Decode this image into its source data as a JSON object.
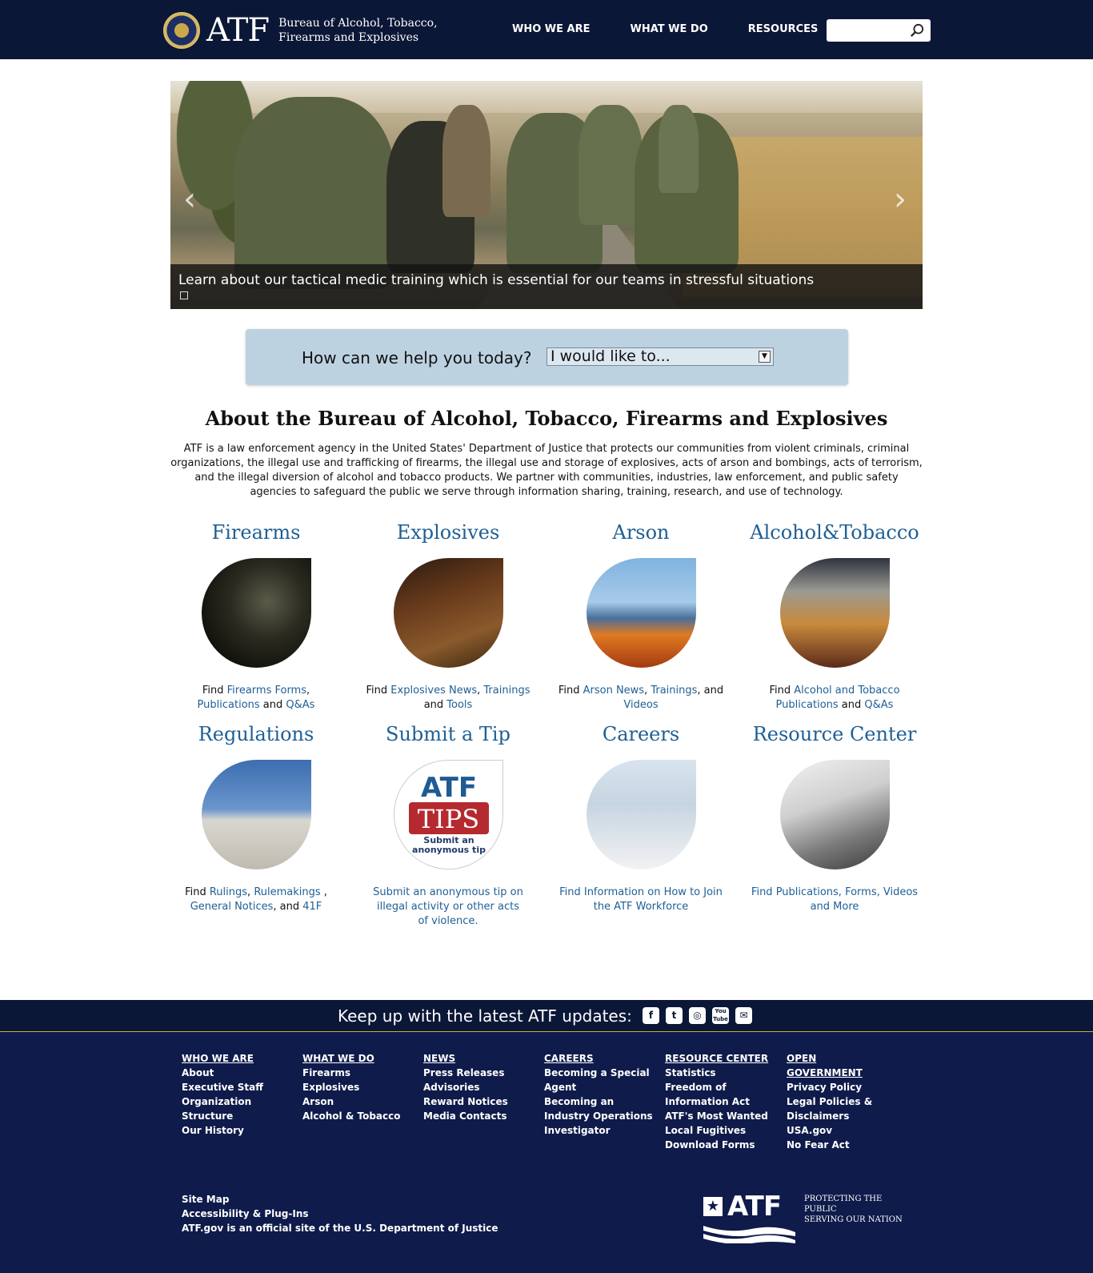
{
  "header": {
    "agency_abbr": "ATF",
    "agency_name": "Bureau of Alcohol, Tobacco, Firearms and Explosives",
    "nav": [
      "WHO WE ARE",
      "WHAT WE DO",
      "RESOURCES"
    ],
    "search": {
      "value": "",
      "placeholder": ""
    }
  },
  "carousel": {
    "caption": "Learn about our tactical medic training which is essential for our teams in stressful situations",
    "prev_icon": "chevron-left-icon",
    "next_icon": "chevron-right-icon"
  },
  "help": {
    "label": "How can we help you today?",
    "select_value": "I would like to..."
  },
  "about": {
    "title": "About the Bureau of Alcohol, Tobacco, Firearms and Explosives",
    "text": "ATF is a law enforcement agency in the United States' Department of Justice that protects our communities from violent criminals, criminal organizations, the illegal use and trafficking of firearms, the illegal use and storage of explosives, acts of arson and bombings, acts of terrorism, and the illegal diversion of alcohol and tobacco products. We partner with communities, industries, law enforcement, and public safety agencies to safeguard the public we serve through information sharing, training, research, and use of technology."
  },
  "categories": [
    {
      "title": "Firearms",
      "desc": {
        "prefix": "Find ",
        "link1": "Firearms Forms",
        "sep1": ", ",
        "link2": "Publications",
        "sep2": " and ",
        "link3": "Q&As"
      }
    },
    {
      "title": "Explosives",
      "desc": {
        "prefix": "Find ",
        "link1": "Explosives News",
        "sep1": ", ",
        "link2": "Trainings",
        "sep2": " and ",
        "link3": "Tools"
      }
    },
    {
      "title": "Arson",
      "desc": {
        "prefix": "Find ",
        "link1": "Arson News",
        "sep1": ", ",
        "link2": "Trainings",
        "sep2": ", and ",
        "link3": "Videos"
      }
    },
    {
      "title": "Alcohol&Tobacco",
      "desc": {
        "prefix": "Find ",
        "link1": "Alcohol and Tobacco Publications",
        "sep1": " and ",
        "link2": "Q&As"
      }
    },
    {
      "title": "Regulations",
      "desc": {
        "prefix": "Find ",
        "link1": "Rulings",
        "sep1": ", ",
        "link2": "Rulemakings",
        "sep2": " , ",
        "link3": "General Notices",
        "sep3": ", and ",
        "link4": "41F"
      }
    },
    {
      "title": "Submit a Tip",
      "desc": {
        "link1": "Submit an anonymous tip on illegal activity or other acts of violence."
      }
    },
    {
      "title": "Careers",
      "desc": {
        "link1": "Find Information on How to Join the ATF Workforce"
      }
    },
    {
      "title": "Resource Center",
      "desc": {
        "link1": "Find Publications, Forms, Videos and More"
      }
    }
  ],
  "tips_image": {
    "atf": "ATF",
    "tips": "TIPS",
    "sub": "Submit an anonymous tip"
  },
  "updates": {
    "text": "Keep up with the latest ATF updates:",
    "social": [
      "facebook-icon",
      "twitter-icon",
      "instagram-icon",
      "youtube-icon",
      "email-icon"
    ]
  },
  "footer": {
    "columns": [
      {
        "head": "WHO WE ARE",
        "links": [
          "About",
          "Executive Staff",
          "Organization Structure",
          "Our History"
        ]
      },
      {
        "head": "WHAT WE DO",
        "links": [
          "Firearms",
          "Explosives",
          "Arson",
          "Alcohol & Tobacco"
        ]
      },
      {
        "head": "NEWS",
        "links": [
          "Press Releases",
          "Advisories",
          "Reward Notices",
          "Media Contacts"
        ]
      },
      {
        "head": "CAREERS",
        "links": [
          "Becoming a Special Agent",
          "Becoming an Industry Operations Investigator"
        ]
      },
      {
        "head": "RESOURCE CENTER",
        "links": [
          "Statistics",
          "Freedom of Information Act",
          "ATF's Most Wanted",
          "Local Fugitives",
          "Download Forms"
        ]
      },
      {
        "head": "OPEN GOVERNMENT",
        "links": [
          "Privacy Policy",
          "Legal Policies & Disclaimers",
          "USA.gov",
          "No Fear Act"
        ]
      }
    ],
    "bottom": [
      "Site Map",
      "Accessibility & Plug-Ins",
      "ATF.gov is an official site of the U.S. Department of Justice"
    ],
    "logo_text": "ATF",
    "tagline": [
      "PROTECTING THE PUBLIC",
      "SERVING OUR NATION"
    ]
  }
}
